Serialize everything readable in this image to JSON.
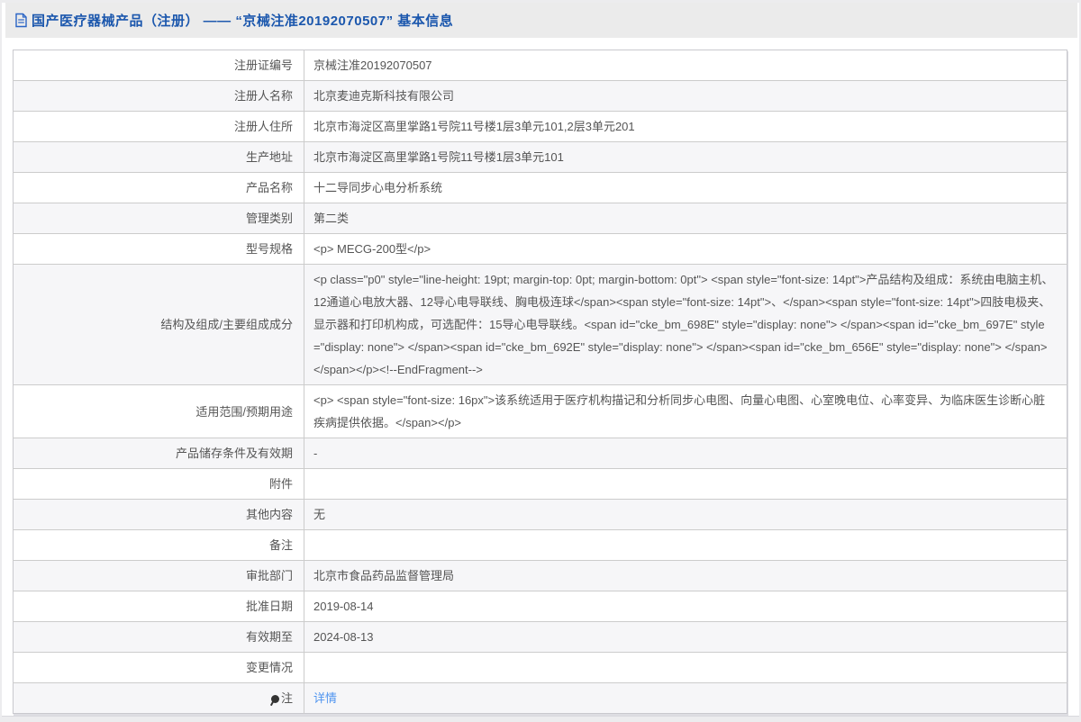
{
  "page": {
    "header": {
      "icon": "document-icon",
      "title": "国产医疗器械产品（注册） —— “京械注准20192070507” 基本信息"
    },
    "colors": {
      "title_blue": "#1b57ad",
      "link_blue": "#4f94ef",
      "header_bar_bg": "#ebebeb",
      "row_alt_bg": "#f6f6f8",
      "table_border": "#cccccc",
      "text": "#555555"
    },
    "table": {
      "rows": [
        {
          "label": "注册证编号",
          "value": "京械注准20192070507"
        },
        {
          "label": "注册人名称",
          "value": "北京麦迪克斯科技有限公司"
        },
        {
          "label": "注册人住所",
          "value": "北京市海淀区高里掌路1号院11号楼1层3单元101,2层3单元201"
        },
        {
          "label": "生产地址",
          "value": "北京市海淀区高里掌路1号院11号楼1层3单元101"
        },
        {
          "label": "产品名称",
          "value": "十二导同步心电分析系统"
        },
        {
          "label": "管理类别",
          "value": "第二类"
        },
        {
          "label": "型号规格",
          "value": "<p> MECG-200型</p>"
        },
        {
          "label": "结构及组成/主要组成成分",
          "value": "<p class=\"p0\" style=\"line-height: 19pt; margin-top: 0pt; margin-bottom: 0pt\"> <span style=\"font-size: 14pt\">产品结构及组成：系统由电脑主机、12通道心电放大器、12导心电导联线、胸电极连球</span><span style=\"font-size: 14pt\">、</span><span style=\"font-size: 14pt\">四肢电极夹、显示器和打印机构成，可选配件：15导心电导联线。<span id=\"cke_bm_698E\" style=\"display: none\"> </span><span id=\"cke_bm_697E\" style=\"display: none\"> </span><span id=\"cke_bm_692E\" style=\"display: none\"> </span><span id=\"cke_bm_656E\" style=\"display: none\"> </span></span></p><!--EndFragment-->"
        },
        {
          "label": "适用范围/预期用途",
          "value": "<p> <span style=\"font-size: 16px\">该系统适用于医疗机构描记和分析同步心电图、向量心电图、心室晚电位、心率变异、为临床医生诊断心脏疾病提供依据。</span></p>"
        },
        {
          "label": "产品储存条件及有效期",
          "value": "-"
        },
        {
          "label": "附件",
          "value": ""
        },
        {
          "label": "其他内容",
          "value": "无"
        },
        {
          "label": "备注",
          "value": ""
        },
        {
          "label": "审批部门",
          "value": "北京市食品药品监督管理局"
        },
        {
          "label": "批准日期",
          "value": "2019-08-14"
        },
        {
          "label": "有效期至",
          "value": "2024-08-13"
        },
        {
          "label": "变更情况",
          "value": ""
        },
        {
          "label": "注",
          "icon": "bulb-icon",
          "link": "详情"
        }
      ]
    }
  }
}
